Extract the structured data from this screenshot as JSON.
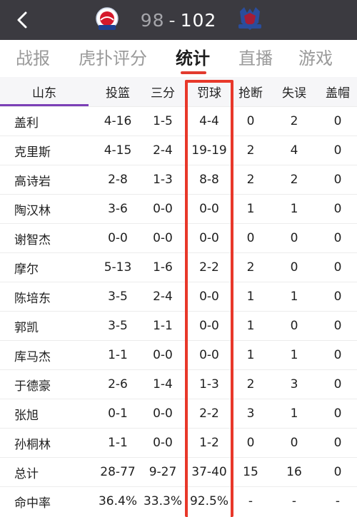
{
  "header": {
    "back_icon": "chevron-left-icon",
    "home_score": "98",
    "separator": "-",
    "away_score": "102",
    "colors": {
      "bar": "#3b3a40",
      "accent": "#e23a2e",
      "highlight": "#e8382a",
      "team_underline": "#7b3fb6"
    }
  },
  "tabs": [
    {
      "label": "战报"
    },
    {
      "label": "虎扑评分"
    },
    {
      "label": "统计",
      "active": true
    },
    {
      "label": "直播"
    },
    {
      "label": "游戏"
    }
  ],
  "table": {
    "columns": [
      "山东",
      "投篮",
      "三分",
      "罚球",
      "抢断",
      "失误",
      "盖帽"
    ],
    "rows": [
      {
        "name": "盖利",
        "fg": "4-16",
        "tp": "1-5",
        "ft": "4-4",
        "stl": "0",
        "to": "2",
        "blk": "0"
      },
      {
        "name": "克里斯",
        "fg": "4-15",
        "tp": "2-4",
        "ft": "19-19",
        "stl": "2",
        "to": "4",
        "blk": "0"
      },
      {
        "name": "高诗岩",
        "fg": "2-8",
        "tp": "1-3",
        "ft": "8-8",
        "stl": "2",
        "to": "2",
        "blk": "0"
      },
      {
        "name": "陶汉林",
        "fg": "3-6",
        "tp": "0-0",
        "ft": "0-0",
        "stl": "1",
        "to": "1",
        "blk": "0"
      },
      {
        "name": "谢智杰",
        "fg": "0-0",
        "tp": "0-0",
        "ft": "0-0",
        "stl": "0",
        "to": "0",
        "blk": "0"
      },
      {
        "name": "摩尔",
        "fg": "5-13",
        "tp": "1-6",
        "ft": "2-2",
        "stl": "2",
        "to": "0",
        "blk": "0"
      },
      {
        "name": "陈培东",
        "fg": "3-5",
        "tp": "2-4",
        "ft": "0-0",
        "stl": "1",
        "to": "1",
        "blk": "0"
      },
      {
        "name": "郭凯",
        "fg": "3-5",
        "tp": "1-1",
        "ft": "0-0",
        "stl": "1",
        "to": "0",
        "blk": "0"
      },
      {
        "name": "库马杰",
        "fg": "1-1",
        "tp": "0-0",
        "ft": "0-0",
        "stl": "1",
        "to": "1",
        "blk": "0"
      },
      {
        "name": "于德豪",
        "fg": "2-6",
        "tp": "1-4",
        "ft": "1-3",
        "stl": "2",
        "to": "3",
        "blk": "0"
      },
      {
        "name": "张旭",
        "fg": "0-1",
        "tp": "0-0",
        "ft": "2-2",
        "stl": "3",
        "to": "1",
        "blk": "0"
      },
      {
        "name": "孙桐林",
        "fg": "1-1",
        "tp": "0-0",
        "ft": "1-2",
        "stl": "0",
        "to": "0",
        "blk": "0"
      },
      {
        "name": "总计",
        "fg": "28-77",
        "tp": "9-27",
        "ft": "37-40",
        "stl": "15",
        "to": "16",
        "blk": "0"
      },
      {
        "name": "命中率",
        "fg": "36.4%",
        "tp": "33.3%",
        "ft": "92.5%",
        "stl": "-",
        "to": "-",
        "blk": "-"
      }
    ]
  }
}
